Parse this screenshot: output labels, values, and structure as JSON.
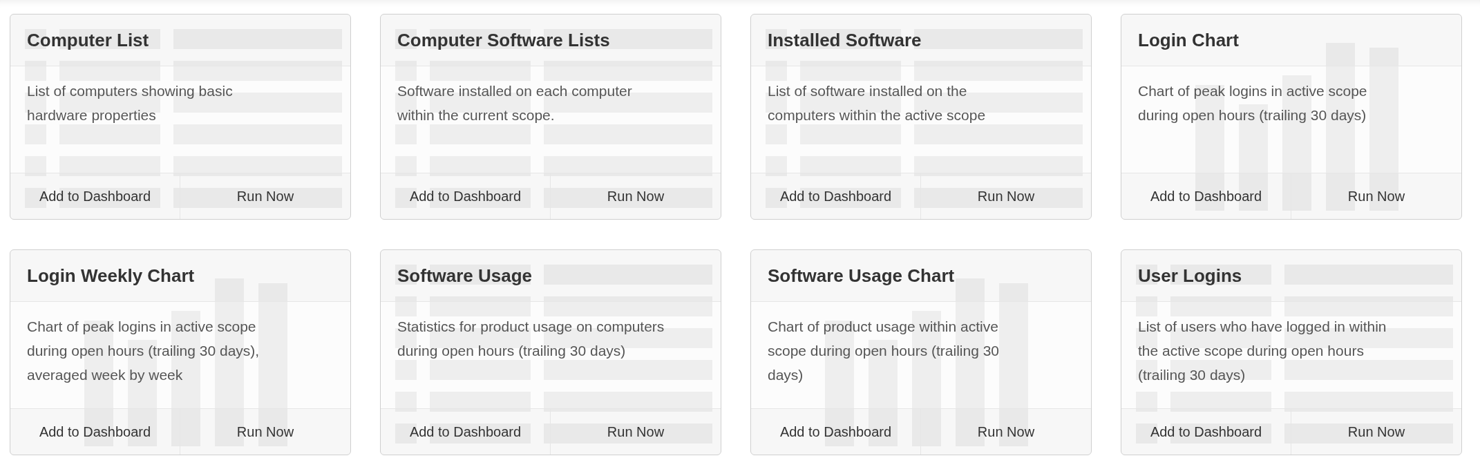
{
  "reports": [
    {
      "title": "Computer List",
      "description": "List of computers showing basic hardware properties",
      "kind": "table",
      "actions": [
        "Add to Dashboard",
        "Run Now"
      ]
    },
    {
      "title": "Computer Software Lists",
      "description": "Software installed on each computer within the current scope.",
      "kind": "table",
      "actions": [
        "Add to Dashboard",
        "Run Now"
      ]
    },
    {
      "title": "Installed Software",
      "description": "List of software installed on the computers within the active scope",
      "kind": "table",
      "actions": [
        "Add to Dashboard",
        "Run Now"
      ]
    },
    {
      "title": "Login Chart",
      "description": "Chart of peak logins in active scope during open hours (trailing 30 days)",
      "kind": "chart",
      "actions": [
        "Add to Dashboard",
        "Run Now"
      ]
    },
    {
      "title": "Login Weekly Chart",
      "description": "Chart of peak logins in active scope during open hours (trailing 30 days), averaged week by week",
      "kind": "chart",
      "actions": [
        "Add to Dashboard",
        "Run Now"
      ]
    },
    {
      "title": "Software Usage",
      "description": "Statistics for product usage on computers during open hours (trailing 30 days)",
      "kind": "table",
      "actions": [
        "Add to Dashboard",
        "Run Now"
      ]
    },
    {
      "title": "Software Usage Chart",
      "description": "Chart of product usage within active scope during open hours (trailing 30 days)",
      "kind": "chart",
      "actions": [
        "Add to Dashboard",
        "Run Now"
      ]
    },
    {
      "title": "User Logins",
      "description": "List of users who have logged in within the active scope during open hours (trailing 30 days)",
      "kind": "table",
      "actions": [
        "Add to Dashboard",
        "Run Now"
      ]
    }
  ]
}
